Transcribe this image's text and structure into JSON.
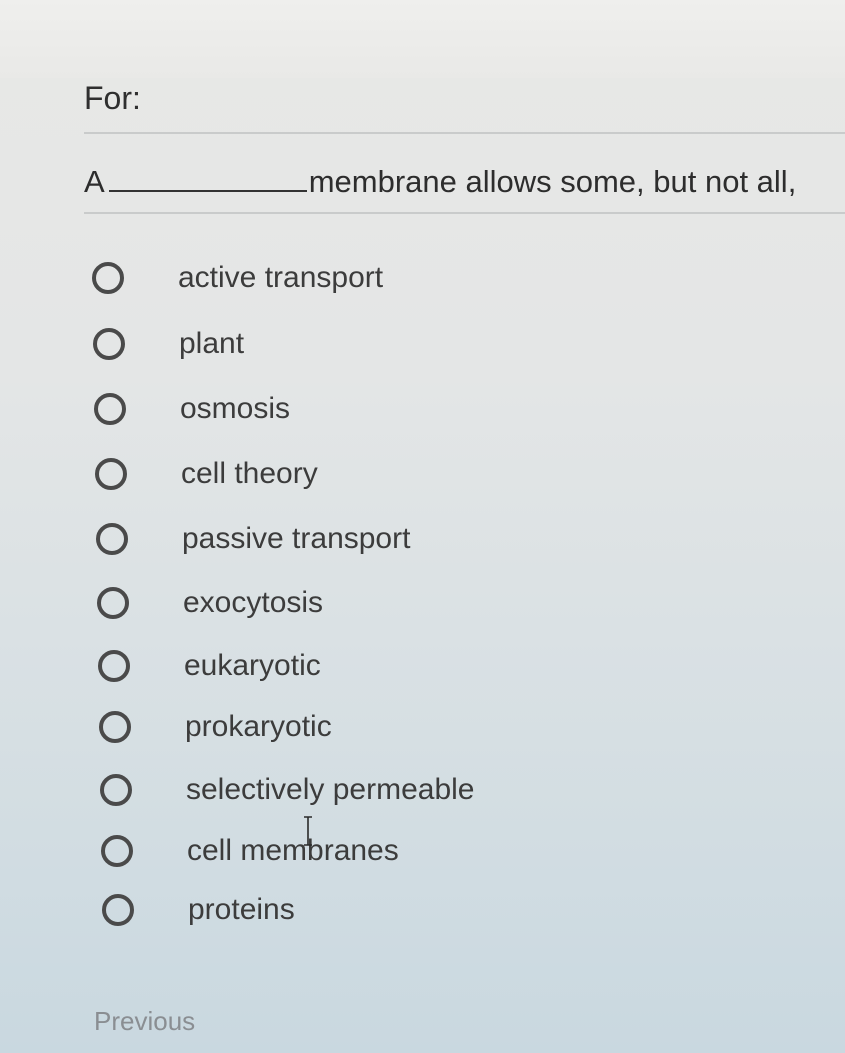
{
  "header": {
    "for_label": "For:"
  },
  "question": {
    "prefix": "A",
    "suffix": "membrane allows some, but not all,"
  },
  "options": [
    {
      "label": "active transport"
    },
    {
      "label": "plant"
    },
    {
      "label": "osmosis"
    },
    {
      "label": "cell theory"
    },
    {
      "label": "passive transport"
    },
    {
      "label": "exocytosis"
    },
    {
      "label": "eukaryotic"
    },
    {
      "label": "prokaryotic"
    },
    {
      "label": "selectively permeable"
    },
    {
      "label": "cell membranes"
    },
    {
      "label": "proteins"
    }
  ],
  "navigation": {
    "previous_label": "Previous"
  },
  "colors": {
    "text": "#3a3a3a",
    "radio_border": "#4a4a4a",
    "previous": "#8a8e92"
  },
  "icons": {
    "radio": "radio-unchecked-icon",
    "cursor": "text-cursor-icon"
  }
}
